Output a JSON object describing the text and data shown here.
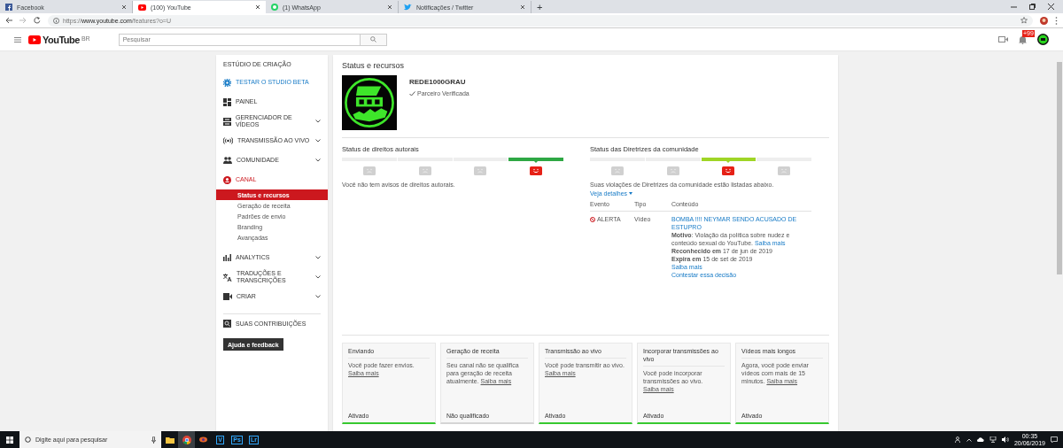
{
  "browser": {
    "tabs": [
      {
        "title": "Facebook",
        "selected": false
      },
      {
        "title": "(100) YouTube",
        "selected": true
      },
      {
        "title": "(1) WhatsApp",
        "selected": false
      },
      {
        "title": "Notificações / Twitter",
        "selected": false
      }
    ],
    "new_tab": "+",
    "url_scheme": "https://",
    "url_host": "www.youtube.com",
    "url_path": "/features?o=U"
  },
  "youtube": {
    "logo_text": "YouTube",
    "logo_badge": "BR",
    "search": {
      "placeholder": "Pesquisar"
    },
    "notification_count": "+99"
  },
  "sidebar": {
    "title": "ESTÚDIO DE CRIAÇÃO",
    "items": [
      {
        "label": "TESTAR O STUDIO BETA",
        "kind": "beta",
        "expandable": false,
        "selected": false
      },
      {
        "label": "PAINEL",
        "kind": "section",
        "expandable": false,
        "selected": false
      },
      {
        "label": "GERENCIADOR DE VÍDEOS",
        "kind": "section",
        "expandable": true,
        "selected": false
      },
      {
        "label": "TRANSMISSÃO AO VIVO",
        "kind": "section",
        "expandable": true,
        "selected": false
      },
      {
        "label": "COMUNIDADE",
        "kind": "section",
        "expandable": true,
        "selected": false
      },
      {
        "label": "CANAL",
        "kind": "section",
        "expandable": false,
        "selected": true,
        "children": [
          {
            "label": "Status e recursos",
            "selected": true
          },
          {
            "label": "Geração de receita",
            "selected": false
          },
          {
            "label": "Padrões de envio",
            "selected": false
          },
          {
            "label": "Branding",
            "selected": false
          },
          {
            "label": "Avançadas",
            "selected": false
          }
        ]
      },
      {
        "label": "ANALYTICS",
        "kind": "section",
        "expandable": true,
        "selected": false
      },
      {
        "label": "TRADUÇÕES E TRANSCRIÇÕES",
        "kind": "section",
        "expandable": true,
        "selected": false
      },
      {
        "label": "CRIAR",
        "kind": "section",
        "expandable": true,
        "selected": false
      },
      {
        "label": "SUAS CONTRIBUIÇÕES",
        "kind": "footer",
        "expandable": false,
        "selected": false
      }
    ],
    "help_button": "Ajuda e feedback"
  },
  "main": {
    "title": "Status e recursos",
    "channel": {
      "name": "REDE1000GRAU",
      "badge": "Parceiro Verificada"
    },
    "copyright": {
      "title": "Status de direitos autorais",
      "strikes": [
        {
          "selected": false
        },
        {
          "selected": false
        },
        {
          "selected": false
        },
        {
          "selected": true
        }
      ],
      "color": "#2ea844",
      "message": "Você não tem avisos de direitos autorais."
    },
    "community": {
      "title": "Status das Diretrizes da comunidade",
      "strikes": [
        {
          "selected": false
        },
        {
          "selected": false
        },
        {
          "selected": true
        },
        {
          "selected": false
        }
      ],
      "color": "#9fd526",
      "message": "Suas violações de Diretrizes da comunidade estão listadas abaixo.",
      "details_link": "Veja detalhes",
      "columns": [
        "Evento",
        "Tipo",
        "Conteúdo"
      ],
      "rows": [
        {
          "event": "ALERTA",
          "type": "Vídeo",
          "video": "BOMBA !!!! NEYMAR SENDO ACUSADO DE ESTUPRO",
          "reason": "**Motivo**: Violação da política sobre nudez e conteúdo sexual do YouTube.",
          "reason_link": "Saiba mais",
          "recognized": "**Reconhecido em** 17 de jun de 2019",
          "expires": "**Expira em** 15 de set de 2019",
          "more_link": "Saiba mais",
          "appeal_link": "Contestar essa decisão"
        }
      ]
    },
    "features": [
      {
        "title": "Enviando",
        "text": "Você pode fazer envios.",
        "link": "Saiba mais",
        "status": "Ativado",
        "enabled": true
      },
      {
        "title": "Geração de receita",
        "text": "Seu canal não se qualifica para geração de receita atualmente.",
        "link": "Saiba mais",
        "status": "Não qualificado",
        "enabled": false
      },
      {
        "title": "Transmissão ao vivo",
        "text": "Você pode transmitir ao vivo.",
        "link": "Saiba mais",
        "status": "Ativado",
        "enabled": true
      },
      {
        "title": "Incorporar transmissões ao vivo",
        "text": "Você pode incorporar transmissões ao vivo.",
        "link": "Saiba mais",
        "status": "Ativado",
        "enabled": true
      },
      {
        "title": "Vídeos mais longos",
        "text": "Agora, você pode enviar vídeos com mais de 15 minutos.",
        "link": "Saiba mais",
        "status": "Ativado",
        "enabled": true
      }
    ]
  },
  "taskbar": {
    "search_placeholder": "Digite aqui para pesquisar",
    "apps": [
      "V",
      "Ps",
      "Lr"
    ],
    "time": "00:35",
    "date": "20/06/2019"
  }
}
